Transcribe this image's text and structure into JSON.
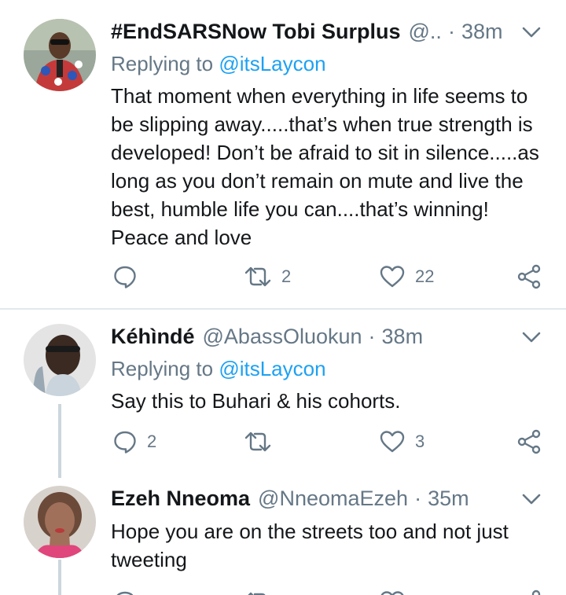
{
  "tweets": [
    {
      "name": "#EndSARSNow Tobi Surplus",
      "handle": "@..",
      "time": "38m",
      "replying_prefix": "Replying to",
      "replying_to": "@itsLaycon",
      "text": "That moment when everything in life seems to be slipping away.....that’s when true strength is developed! Don’t be afraid to sit in silence.....as long as you don’t remain on mute and live the best, humble life you can....that’s winning! Peace and love",
      "reply_count": "",
      "retweet_count": "2",
      "like_count": "22"
    },
    {
      "name": "Kéhìndé",
      "handle": "@AbassOluokun",
      "time": "38m",
      "replying_prefix": "Replying to",
      "replying_to": "@itsLaycon",
      "text": "Say this to Buhari & his cohorts.",
      "reply_count": "2",
      "retweet_count": "",
      "like_count": "3"
    },
    {
      "name": "Ezeh Nneoma",
      "handle": "@NneomaEzeh",
      "time": "35m",
      "text": "Hope you are on the streets too and not just tweeting"
    }
  ],
  "icons": {
    "reply": "reply-icon",
    "retweet": "retweet-icon",
    "like": "heart-icon",
    "share": "share-icon",
    "caret": "chevron-down-icon"
  },
  "colors": {
    "text": "#14171a",
    "secondary": "#657786",
    "link": "#1da1f2",
    "separator": "#e1e8ed",
    "thread_line": "#ccd6dd"
  }
}
